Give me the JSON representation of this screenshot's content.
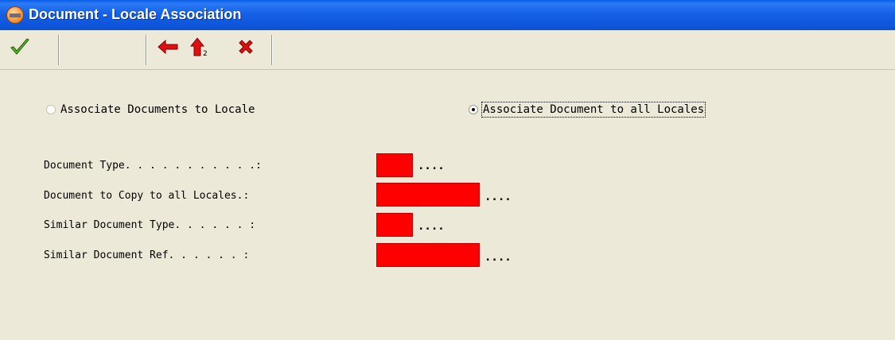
{
  "window": {
    "title": "Document - Locale Association"
  },
  "toolbar": {
    "buttons": [
      {
        "name": "ok",
        "icon": "checkmark-icon",
        "color": "#3C9A1E"
      },
      {
        "name": "back",
        "icon": "left-arrow-icon",
        "color": "#E01010"
      },
      {
        "name": "up",
        "icon": "up-arrow-icon",
        "color": "#E01010"
      },
      {
        "name": "cancel",
        "icon": "close-icon",
        "color": "#E01010"
      }
    ]
  },
  "options": {
    "option1": {
      "label": "Associate Documents to Locale",
      "selected": false
    },
    "option2": {
      "label": "Associate Document to all Locales",
      "selected": true
    }
  },
  "form": {
    "fields": [
      {
        "label": "Document Type. . . . . . . . . . .:",
        "value": "",
        "ellipsis": "...."
      },
      {
        "label": "Document to Copy to all Locales.:",
        "value": "",
        "ellipsis": "...."
      },
      {
        "label": "Similar Document Type. . . . . . :",
        "value": "",
        "ellipsis": "...."
      },
      {
        "label": "Similar Document Ref. . . . . . :",
        "value": "",
        "ellipsis": "...."
      }
    ],
    "field_color": "#FF0000"
  }
}
